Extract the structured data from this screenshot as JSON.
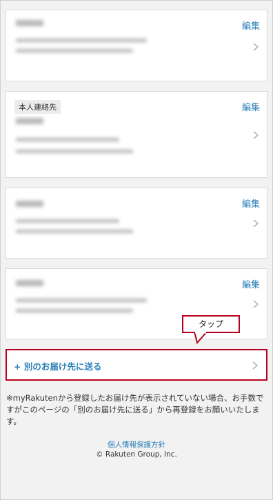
{
  "cards": [
    {
      "edit_label": "編集"
    },
    {
      "tag": "本人連絡先",
      "edit_label": "編集"
    },
    {
      "edit_label": "編集"
    },
    {
      "edit_label": "編集"
    }
  ],
  "add_address": {
    "label": "+ 別のお届け先に送る"
  },
  "callout": {
    "text": "タップ"
  },
  "note": {
    "text": "※myRakutenから登録したお届け先が表示されていない場合、お手数ですがこのページの「別のお届け先に送る」から再登録をお願いいたします。"
  },
  "footer": {
    "privacy_link": "個人情報保護方針",
    "copyright": "© Rakuten Group, Inc."
  },
  "colors": {
    "link": "#2a7fb8",
    "highlight": "#b5001e",
    "background": "#f2f2f2"
  },
  "icons": [
    "chevron-right-icon"
  ]
}
